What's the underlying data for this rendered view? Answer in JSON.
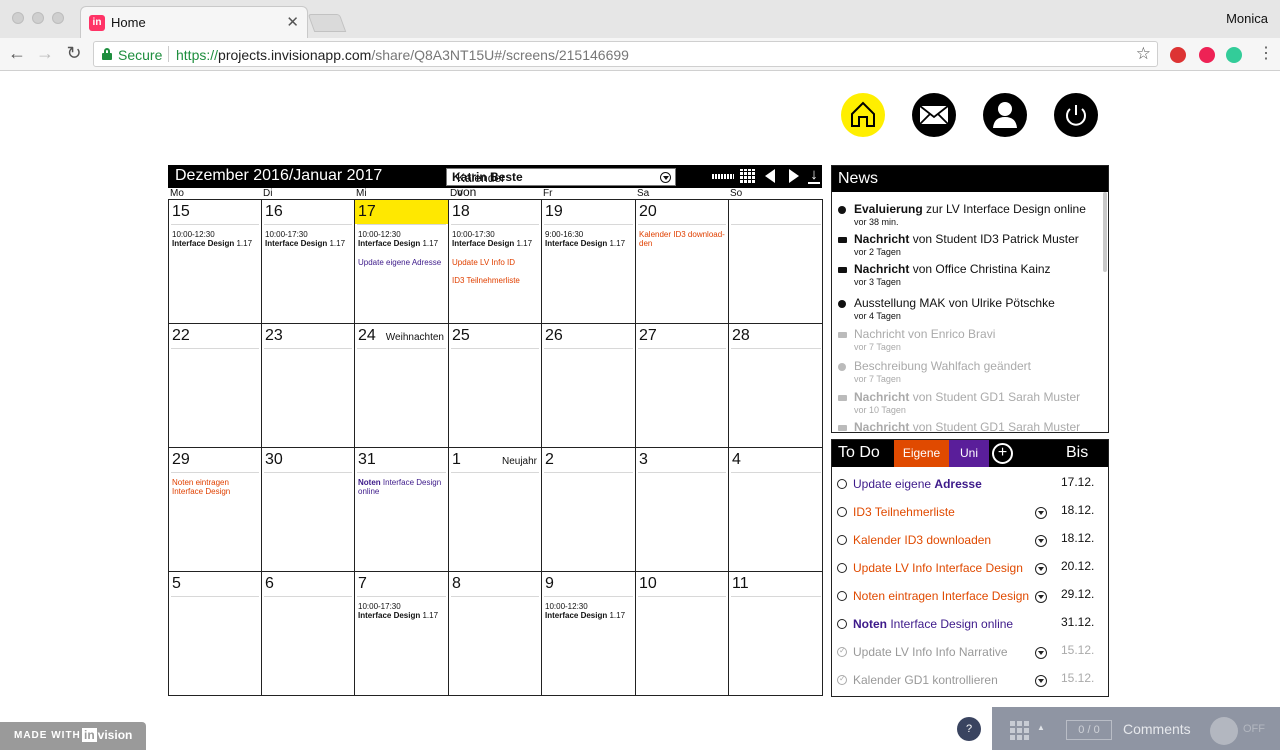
{
  "browser": {
    "tab_title": "Home",
    "tab_close": "✕",
    "favicon": "in",
    "profile": "Monica",
    "secure_label": "Secure",
    "url_scheme": "https://",
    "url_host": "projects.invisionapp.com",
    "url_path": "/share/Q8A3NT15U#/screens/215146699",
    "icons": [
      "back-icon",
      "forward-icon",
      "reload-icon",
      "lock-icon",
      "star-icon"
    ]
  },
  "header_icons": [
    "home-icon",
    "mail-icon",
    "user-icon",
    "power-icon"
  ],
  "colors": {
    "highlight": "#ffe800",
    "orange": "#e04a00",
    "purple": "#5a1e9a"
  },
  "calendar": {
    "title": "Dezember 2016/Januar 2017",
    "select_prefix": "Kalender von ",
    "select_name": "Katrin Beste",
    "weekdays": [
      "Mo",
      "Di",
      "Mi",
      "Do",
      "Fr",
      "Sa",
      "So"
    ],
    "weeks": [
      [
        {
          "num": "15",
          "events": [
            {
              "time": "10:00-12:30",
              "title": "Interface Design",
              "room": "1.17"
            }
          ]
        },
        {
          "num": "16",
          "events": [
            {
              "time": "10:00-17:30",
              "title": "Interface Design",
              "room": "1.17"
            }
          ]
        },
        {
          "num": "17",
          "today": true,
          "events": [
            {
              "time": "10:00-12:30",
              "title": "Interface Design",
              "room": "1.17"
            }
          ],
          "notes": [
            {
              "text": "Update eigene Adresse",
              "color": "purple"
            }
          ]
        },
        {
          "num": "18",
          "events": [
            {
              "time": "10:00-17:30",
              "title": "Interface Design",
              "room": "1.17"
            }
          ],
          "notes": [
            {
              "text": "Update LV Info ID",
              "color": "orange"
            },
            {
              "text": "ID3 Teilnehmerliste",
              "color": "orange"
            }
          ]
        },
        {
          "num": "19",
          "events": [
            {
              "time": "9:00-16:30",
              "title": "Interface Design",
              "room": "1.17"
            }
          ]
        },
        {
          "num": "20",
          "notes": [
            {
              "text": "Kalender ID3 download-\nden",
              "color": "orange"
            }
          ]
        },
        {
          "num": ""
        }
      ],
      [
        {
          "num": "22"
        },
        {
          "num": "23"
        },
        {
          "num": "24",
          "holiday": "Weihnachten"
        },
        {
          "num": "25"
        },
        {
          "num": "26"
        },
        {
          "num": "27"
        },
        {
          "num": "28"
        }
      ],
      [
        {
          "num": "29",
          "notes": [
            {
              "text": "Noten eintragen\nInterface Design",
              "color": "orange"
            }
          ]
        },
        {
          "num": "30"
        },
        {
          "num": "31",
          "notes": [
            {
              "bold": "Noten",
              "text": " Interface Design\nonline",
              "color": "purple"
            }
          ]
        },
        {
          "num": "1",
          "holiday": "Neujahr"
        },
        {
          "num": "2"
        },
        {
          "num": "3"
        },
        {
          "num": "4"
        }
      ],
      [
        {
          "num": "5"
        },
        {
          "num": "6"
        },
        {
          "num": "7",
          "events": [
            {
              "time": "10:00-17:30",
              "title": "Interface Design",
              "room": "1.17"
            }
          ]
        },
        {
          "num": "8"
        },
        {
          "num": "9",
          "events": [
            {
              "time": "10:00-12:30",
              "title": "Interface Design",
              "room": "1.17"
            }
          ]
        },
        {
          "num": "10"
        },
        {
          "num": "11"
        }
      ]
    ]
  },
  "news": {
    "title": "News",
    "items": [
      {
        "icon": "dot",
        "bold": "Evaluierung",
        "text": " zur LV Interface Design online",
        "sub": "vor 38 min.",
        "old": false
      },
      {
        "icon": "mail",
        "bold": "Nachricht",
        "text": " von Student ID3 Patrick Muster",
        "sub": "vor 2 Tagen",
        "old": false
      },
      {
        "icon": "mail",
        "bold": "Nachricht",
        "text": " von Office Christina Kainz",
        "sub": "vor 3 Tagen",
        "old": false
      },
      {
        "icon": "dot",
        "bold": "",
        "text": "Ausstellung MAK von Ulrike Pötschke",
        "sub": "vor 4 Tagen",
        "old": false
      },
      {
        "icon": "mail",
        "bold": "",
        "text": "Nachricht von Enrico Bravi",
        "sub": "vor 7 Tagen",
        "old": true
      },
      {
        "icon": "dot",
        "bold": "",
        "text": "Beschreibung Wahlfach geändert",
        "sub": "vor 7 Tagen",
        "old": true
      },
      {
        "icon": "mail",
        "bold": "Nachricht",
        "text": " von Student GD1 Sarah Muster",
        "sub": "vor 10 Tagen",
        "old": true
      },
      {
        "icon": "mail",
        "bold": "Nachricht",
        "text": " von Student GD1 Sarah Muster",
        "sub": "",
        "old": true
      }
    ]
  },
  "todo": {
    "title": "To Do",
    "tab_eigene": "Eigene",
    "tab_uni": "Uni",
    "add": "+",
    "bis": "Bis",
    "items": [
      {
        "pre": "Update eigene ",
        "bold": "Adresse",
        "post": "",
        "color": "purple",
        "date": "17.12.",
        "more": false,
        "done": false
      },
      {
        "pre": "ID3 Teilnehmerliste",
        "bold": "",
        "post": "",
        "color": "orange",
        "date": "18.12.",
        "more": true,
        "done": false
      },
      {
        "pre": "Kalender ID3 downloaden",
        "bold": "",
        "post": "",
        "color": "orange",
        "date": "18.12.",
        "more": true,
        "done": false
      },
      {
        "pre": "Update LV Info Interface Design",
        "bold": "",
        "post": "",
        "color": "orange",
        "date": "20.12.",
        "more": true,
        "done": false
      },
      {
        "pre": "Noten eintragen Interface Design",
        "bold": "",
        "post": "",
        "color": "orange",
        "date": "29.12.",
        "more": true,
        "done": false
      },
      {
        "pre": "",
        "bold": "Noten",
        "post": " Interface Design online",
        "color": "purple",
        "date": "31.12.",
        "more": false,
        "done": false
      },
      {
        "pre": "Update LV Info Info Narrative",
        "bold": "",
        "post": "",
        "color": "grey",
        "date": "15.12.",
        "more": true,
        "done": true
      },
      {
        "pre": "Kalender GD1 kontrollieren",
        "bold": "",
        "post": "",
        "color": "grey",
        "date": "15.12.",
        "more": true,
        "done": true
      }
    ]
  },
  "footer": {
    "made_with": "MADE WITH",
    "logo_in": "in",
    "logo_rest": "vision",
    "help": "?",
    "counter": "0 / 0",
    "comments": "Comments",
    "toggle": "OFF"
  }
}
